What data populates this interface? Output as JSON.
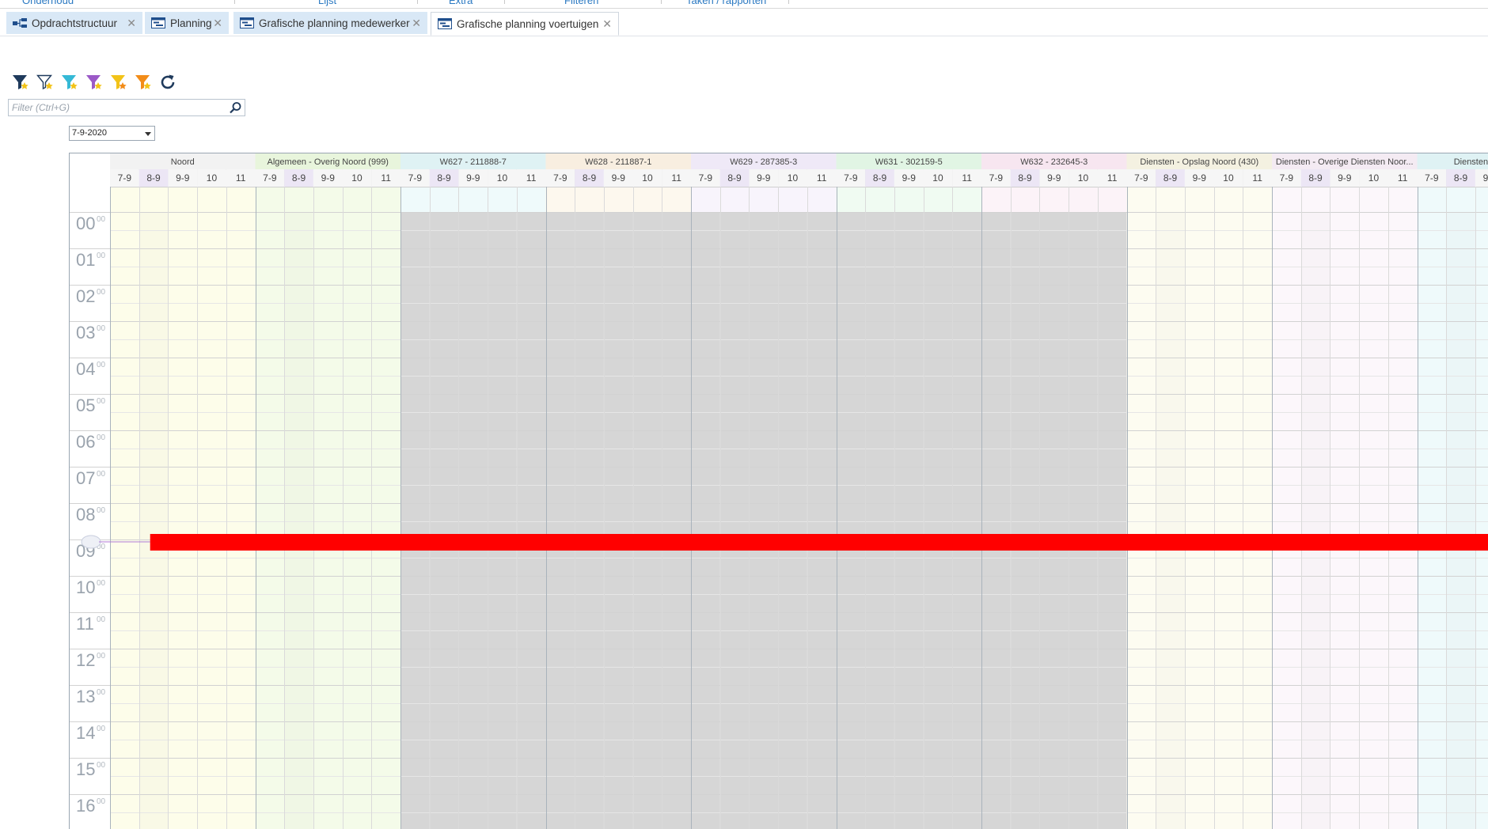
{
  "ribbon": {
    "items": [
      "Onderhoud",
      "Lijst",
      "Extra",
      "Filteren",
      "Taken / rapporten"
    ]
  },
  "tabs": [
    {
      "label": "Opdrachtstructuur",
      "icon": "tree-structure-icon",
      "active": false
    },
    {
      "label": "Planning",
      "icon": "planning-icon",
      "active": false
    },
    {
      "label": "Grafische planning medewerker",
      "icon": "graphic-planning-icon",
      "active": false
    },
    {
      "label": "Grafische planning voertuigen",
      "icon": "graphic-planning-icon",
      "active": true
    }
  ],
  "toolbar": {
    "buttons": [
      {
        "icon": "filter-dark-icon",
        "color": "#1f3a5c"
      },
      {
        "icon": "filter-outline-icon",
        "color": "#1f3a5c"
      },
      {
        "icon": "filter-cyan-icon",
        "color": "#35b9d6"
      },
      {
        "icon": "filter-purple-icon",
        "color": "#9b59c7"
      },
      {
        "icon": "filter-yellow-icon",
        "color": "#f2c318"
      },
      {
        "icon": "filter-orange-icon",
        "color": "#f28c18"
      },
      {
        "icon": "refresh-icon",
        "color": "#1f3a5c"
      }
    ]
  },
  "filter": {
    "placeholder": "Filter (Ctrl+G)",
    "value": ""
  },
  "date": {
    "value": "7-9-2020"
  },
  "schedule": {
    "days": [
      "7-9",
      "8-9",
      "9-9",
      "10",
      "11"
    ],
    "hours": [
      "00",
      "01",
      "02",
      "03",
      "04",
      "05",
      "06",
      "07",
      "08",
      "09",
      "10",
      "11",
      "12",
      "13",
      "14",
      "15",
      "16"
    ],
    "minute_suffix": "00",
    "current_time_hour": "09",
    "resources": [
      {
        "label": "Noord",
        "header_color": "#f2f2f2",
        "cell_color": "#fdfdea",
        "unavailable": false
      },
      {
        "label": "Algemeen - Overig Noord (999)",
        "header_color": "#e8f5dc",
        "cell_color": "#f4fbe9",
        "unavailable": false
      },
      {
        "label": "W627 - 211888-7",
        "header_color": "#dff2f4",
        "cell_color": "#effafb",
        "unavailable": true
      },
      {
        "label": "W628 - 211887-1",
        "header_color": "#f8eee0",
        "cell_color": "#fdf8ee",
        "unavailable": true
      },
      {
        "label": "W629 - 287385-3",
        "header_color": "#efe9f7",
        "cell_color": "#f8f4fc",
        "unavailable": true
      },
      {
        "label": "W631 - 302159-5",
        "header_color": "#e1f5e4",
        "cell_color": "#f0fbf2",
        "unavailable": true
      },
      {
        "label": "W632 - 232645-3",
        "header_color": "#f7e6f0",
        "cell_color": "#fcf3f8",
        "unavailable": true
      },
      {
        "label": "Diensten - Opslag Noord (430)",
        "header_color": "#f4f1e1",
        "cell_color": "#fdfcf1",
        "unavailable": false
      },
      {
        "label": "Diensten - Overige Diensten Noor...",
        "header_color": "#f4ebf3",
        "cell_color": "#fcf7fb",
        "unavailable": false
      },
      {
        "label": "Diensten - Verkeer",
        "header_color": "#dff2f4",
        "cell_color": "#effafb",
        "unavailable": false
      }
    ],
    "colors": {
      "unavailable": "#d6d6d6",
      "now_line": "#ff0000",
      "grid": "#dcdcdc",
      "group_border": "#a9b3bc"
    }
  }
}
